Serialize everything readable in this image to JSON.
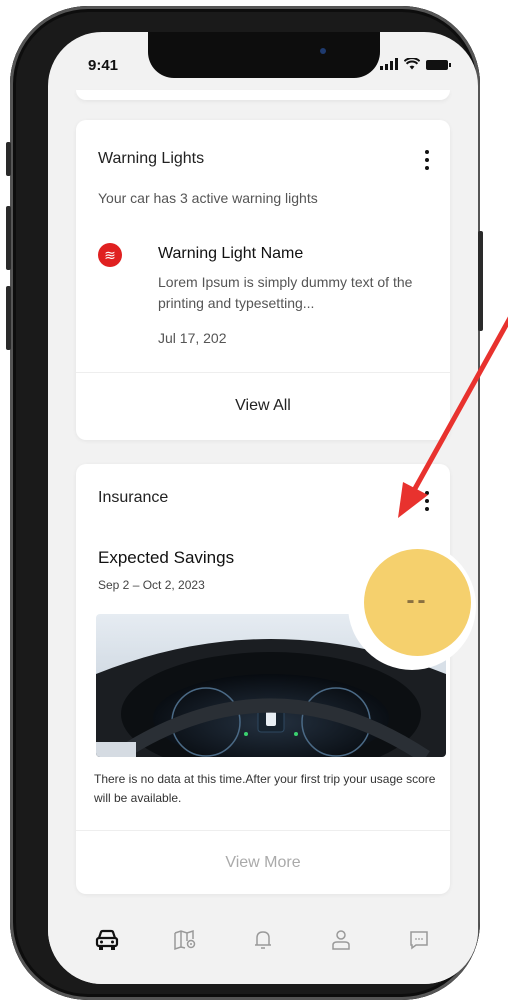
{
  "status_bar": {
    "time": "9:41"
  },
  "warning_card": {
    "title": "Warning Lights",
    "subtitle": "Your car has 3 active warning lights",
    "item": {
      "icon": "warning-light-icon",
      "name": "Warning Light Name",
      "description": "Lorem Ipsum is simply dummy text of the printing and typesetting...",
      "date": "Jul 17, 202"
    },
    "action_label": "View All"
  },
  "insurance_card": {
    "title": "Insurance",
    "savings_title": "Expected Savings",
    "savings_period": "Sep 2 – Oct 2, 2023",
    "savings_value": "--",
    "image": "vehicle-dashboard-photo",
    "no_data_text": "There is no data at this time.After your first trip your usage score will be available.",
    "action_label": "View More"
  },
  "tab_bar": {
    "items": [
      {
        "icon": "car-icon",
        "active": true
      },
      {
        "icon": "map-icon",
        "active": false
      },
      {
        "icon": "bell-icon",
        "active": false
      },
      {
        "icon": "user-icon",
        "active": false
      },
      {
        "icon": "chat-icon",
        "active": false
      }
    ]
  },
  "colors": {
    "warning_red": "#e02020",
    "highlight_yellow": "#f5d06d",
    "annotation_arrow": "#e8322e",
    "muted_text": "#aaaaaa"
  }
}
